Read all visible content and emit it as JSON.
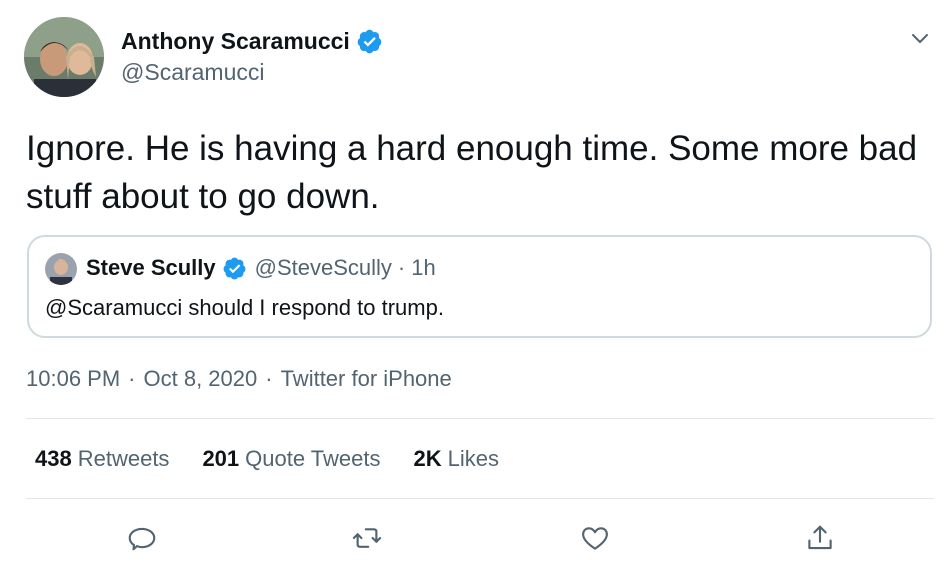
{
  "tweet": {
    "author": {
      "name": "Anthony Scaramucci",
      "handle": "@Scaramucci",
      "verified": true,
      "avatar_icon": "profile-photo"
    },
    "text": "Ignore. He is having a hard enough time. Some more bad stuff about to go down.",
    "quoted_tweet": {
      "author_name": "Steve Scully",
      "author_handle": "@SteveScully",
      "separator": "·",
      "time": "1h",
      "verified": true,
      "text": "@Scaramucci should I respond to trump."
    },
    "meta": {
      "time": "10:06 PM",
      "separator": "·",
      "date": "Oct 8, 2020",
      "source": "Twitter for iPhone"
    },
    "stats": {
      "retweets_count": "438",
      "retweets_label": "Retweets",
      "quotes_count": "201",
      "quotes_label": "Quote Tweets",
      "likes_count": "2K",
      "likes_label": "Likes"
    },
    "actions": [
      "reply-icon",
      "retweet-icon",
      "like-icon",
      "share-icon"
    ],
    "colors": {
      "verified_blue": "#1d9bf0",
      "secondary_text": "#536471",
      "border": "#cfd9de",
      "action_icon": "#536471"
    }
  }
}
